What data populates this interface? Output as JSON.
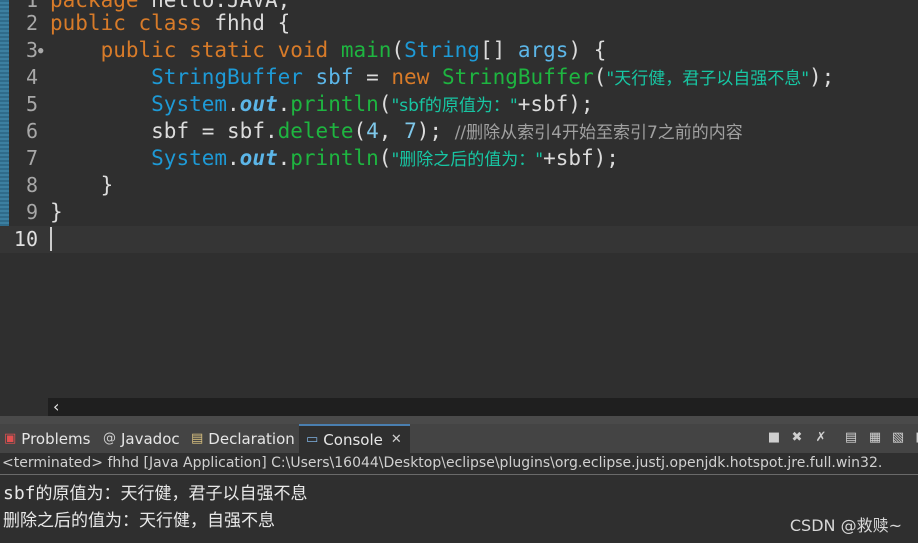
{
  "editor": {
    "line_numbers": [
      "1",
      "2",
      "3",
      "4",
      "5",
      "6",
      "7",
      "8",
      "9",
      "10"
    ],
    "code": {
      "l1_kw": "package",
      "l1_rest": " hello.JAVA;",
      "l2_kw1": "public",
      "l2_kw2": "class",
      "l2_rest": " fhhd {",
      "l3_kw1": "public",
      "l3_kw2": "static",
      "l3_kw3": "void",
      "l3_meth": "main",
      "l3_cls": "String",
      "l3_brk": "[] ",
      "l3_var": "args",
      "l3_end": ") {",
      "l4_cls": "StringBuffer",
      "l4_var": "sbf",
      "l4_eq": " = ",
      "l4_new": "new",
      "l4_cls2": "StringBuffer",
      "l4_str": "\"天行健，君子以自强不息\"",
      "l4_end": ");",
      "l5_cls": "System",
      "l5_field": "out",
      "l5_meth": "println",
      "l5_str": "\"sbf的原值为：\"",
      "l5_rest": "+sbf);",
      "l6_var": "sbf",
      "l6_eq": " = ",
      "l6_var2": "sbf",
      "l6_meth": "delete",
      "l6_n1": "4",
      "l6_n2": "7",
      "l6_end": "); ",
      "l6_cmt": "//删除从索引4开始至索引7之前的内容",
      "l7_cls": "System",
      "l7_field": "out",
      "l7_meth": "println",
      "l7_str": "\"删除之后的值为：\"",
      "l7_rest": "+sbf);",
      "l8": "}",
      "l9": "}"
    }
  },
  "tabs": {
    "problems": "Problems",
    "javadoc": "Javadoc",
    "declaration": "Declaration",
    "console": "Console"
  },
  "console": {
    "terminated": "<terminated> fhhd [Java Application] C:\\Users\\16044\\Desktop\\eclipse\\plugins\\org.eclipse.justj.openjdk.hotspot.jre.full.win32.",
    "out1_a": "sbf",
    "out1_b": "的原值为：天行健，君子以自强不息",
    "out2": "删除之后的值为：天行健，自强不息"
  },
  "watermark": "CSDN @救赎~"
}
